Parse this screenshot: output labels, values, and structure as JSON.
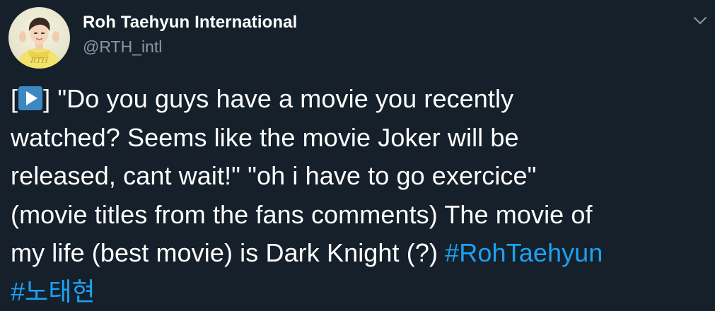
{
  "author": {
    "display_name": "Roh Taehyun International",
    "handle": "@RTH_intl",
    "avatar_text": "RTH"
  },
  "tweet": {
    "line1_prefix": "[",
    "play_icon": "play-button-emoji",
    "line1_rest": "] \"Do you guys have a movie you recently",
    "line2": "watched? Seems like the movie Joker will be",
    "line3": "released, cant wait!\" \"oh i have to go exercice\"",
    "line4": "(movie titles from the fans comments) The movie of",
    "line5_text": "my life (best movie) is Dark Knight (?) ",
    "hashtag1": "#RohTaehyun",
    "hashtag2": "#노태현"
  },
  "colors": {
    "background": "#15202b",
    "text": "#ffffff",
    "secondary": "#8899a6",
    "link": "#1da1f2",
    "emoji_blue": "#3b88c3"
  },
  "icons": {
    "menu": "chevron-down-icon"
  }
}
